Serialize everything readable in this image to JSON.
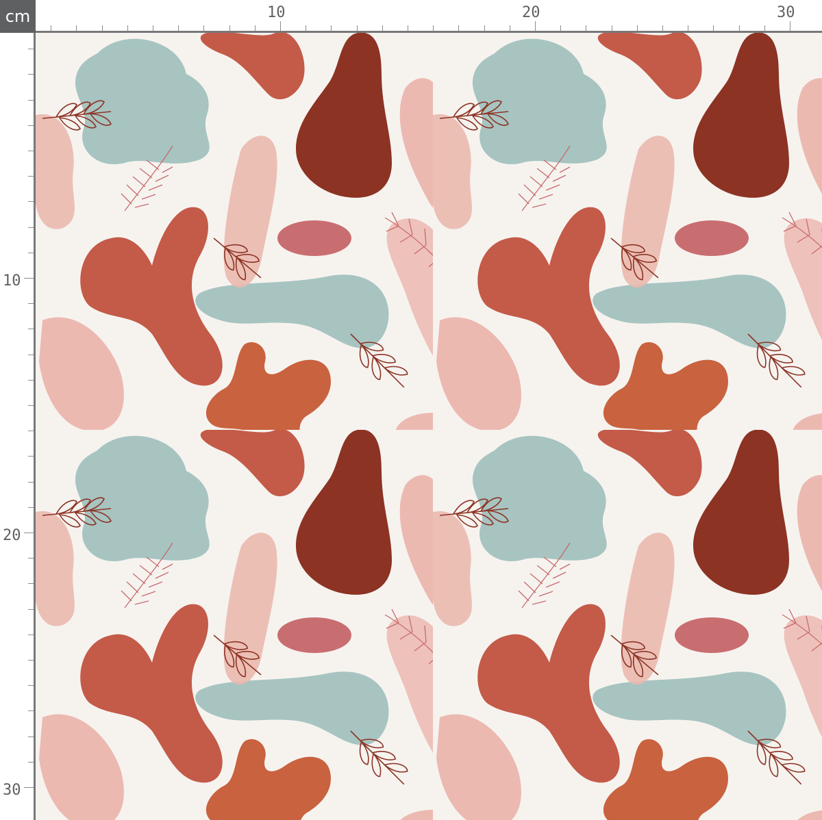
{
  "ruler": {
    "unit": "cm",
    "top_labels": [
      "10",
      "20",
      "30"
    ],
    "left_labels": [
      "10",
      "20",
      "30"
    ]
  },
  "palette": {
    "background": "#f6f3ef",
    "sage": "#a7c4c1",
    "blush": "#ecb9b0",
    "rust": "#c45a48",
    "orange": "#c9623f",
    "maroon": "#8c3324",
    "rose": "#c96e70",
    "leaf_line": "#8c3324",
    "fern_line": "#c76a6c"
  },
  "pattern": {
    "tile_repeat_cm": 16
  }
}
